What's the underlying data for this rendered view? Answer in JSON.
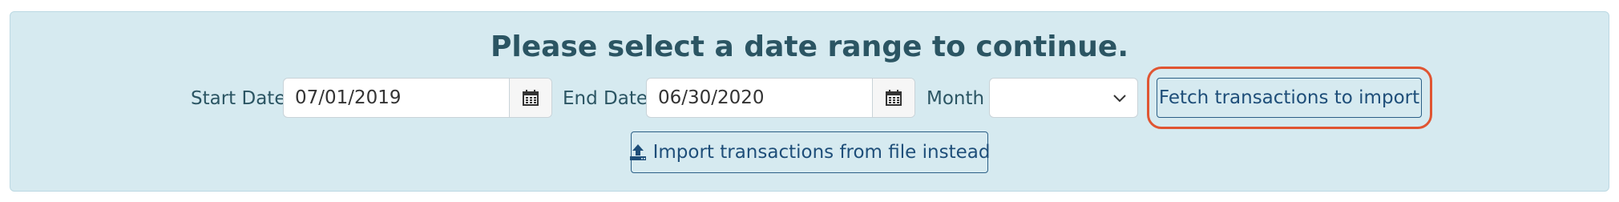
{
  "title": "Please select a date range to continue.",
  "start_date": {
    "label": "Start Date",
    "value": "07/01/2019"
  },
  "end_date": {
    "label": "End Date",
    "value": "06/30/2020"
  },
  "month": {
    "label": "Month",
    "value": ""
  },
  "buttons": {
    "fetch": "Fetch transactions to import",
    "import_file": "Import transactions from file instead"
  },
  "colors": {
    "panel": "#d6eaf0",
    "text": "#2b5563",
    "button_border": "#2b5f86",
    "highlight": "#e05532"
  },
  "icons": {
    "calendar": "calendar-icon",
    "chevron": "chevron-down-icon",
    "upload": "upload-icon"
  }
}
